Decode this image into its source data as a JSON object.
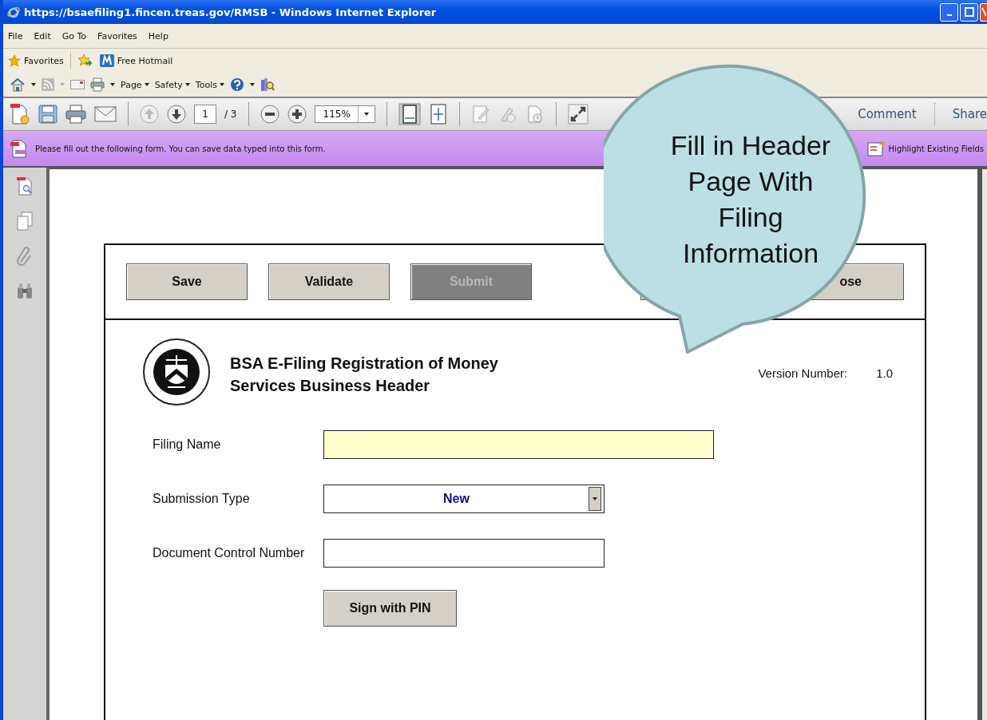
{
  "window": {
    "title": "https://bsaefiling1.fincen.treas.gov/RMSB - Windows Internet Explorer"
  },
  "menu": [
    "File",
    "Edit",
    "Go To",
    "Favorites",
    "Help"
  ],
  "favorites_bar": {
    "favorites": "Favorites",
    "links": [
      "Free Hotmail"
    ]
  },
  "command_bar": [
    "Page",
    "Safety",
    "Tools"
  ],
  "pdf_toolbar": {
    "page": "1",
    "page_count": "/ 3",
    "zoom": "115%",
    "tasks": [
      "Comment",
      "Share"
    ]
  },
  "form_bar": {
    "message": "Please fill out the following form. You can save data typed into this form.",
    "highlight_button": "Highlight Existing Fields"
  },
  "form": {
    "buttons": [
      {
        "label": "Save",
        "disabled": false
      },
      {
        "label": "Validate",
        "disabled": false
      },
      {
        "label": "Submit",
        "disabled": true
      },
      {
        "label": "ose",
        "disabled": false
      }
    ],
    "title": "BSA E-Filing Registration of Money Services Business Header",
    "version_label": "Version Number:",
    "version": "1.0",
    "fields": [
      {
        "label": "Filing Name",
        "kind": "text",
        "highlighted": true
      },
      {
        "label": "Submission Type",
        "kind": "select",
        "value": "New"
      },
      {
        "label": "Document Control Number",
        "kind": "text",
        "highlighted": false
      }
    ],
    "sign_button": "Sign with PIN"
  },
  "callout": {
    "text": "Fill in Header Page With Filing Information"
  }
}
